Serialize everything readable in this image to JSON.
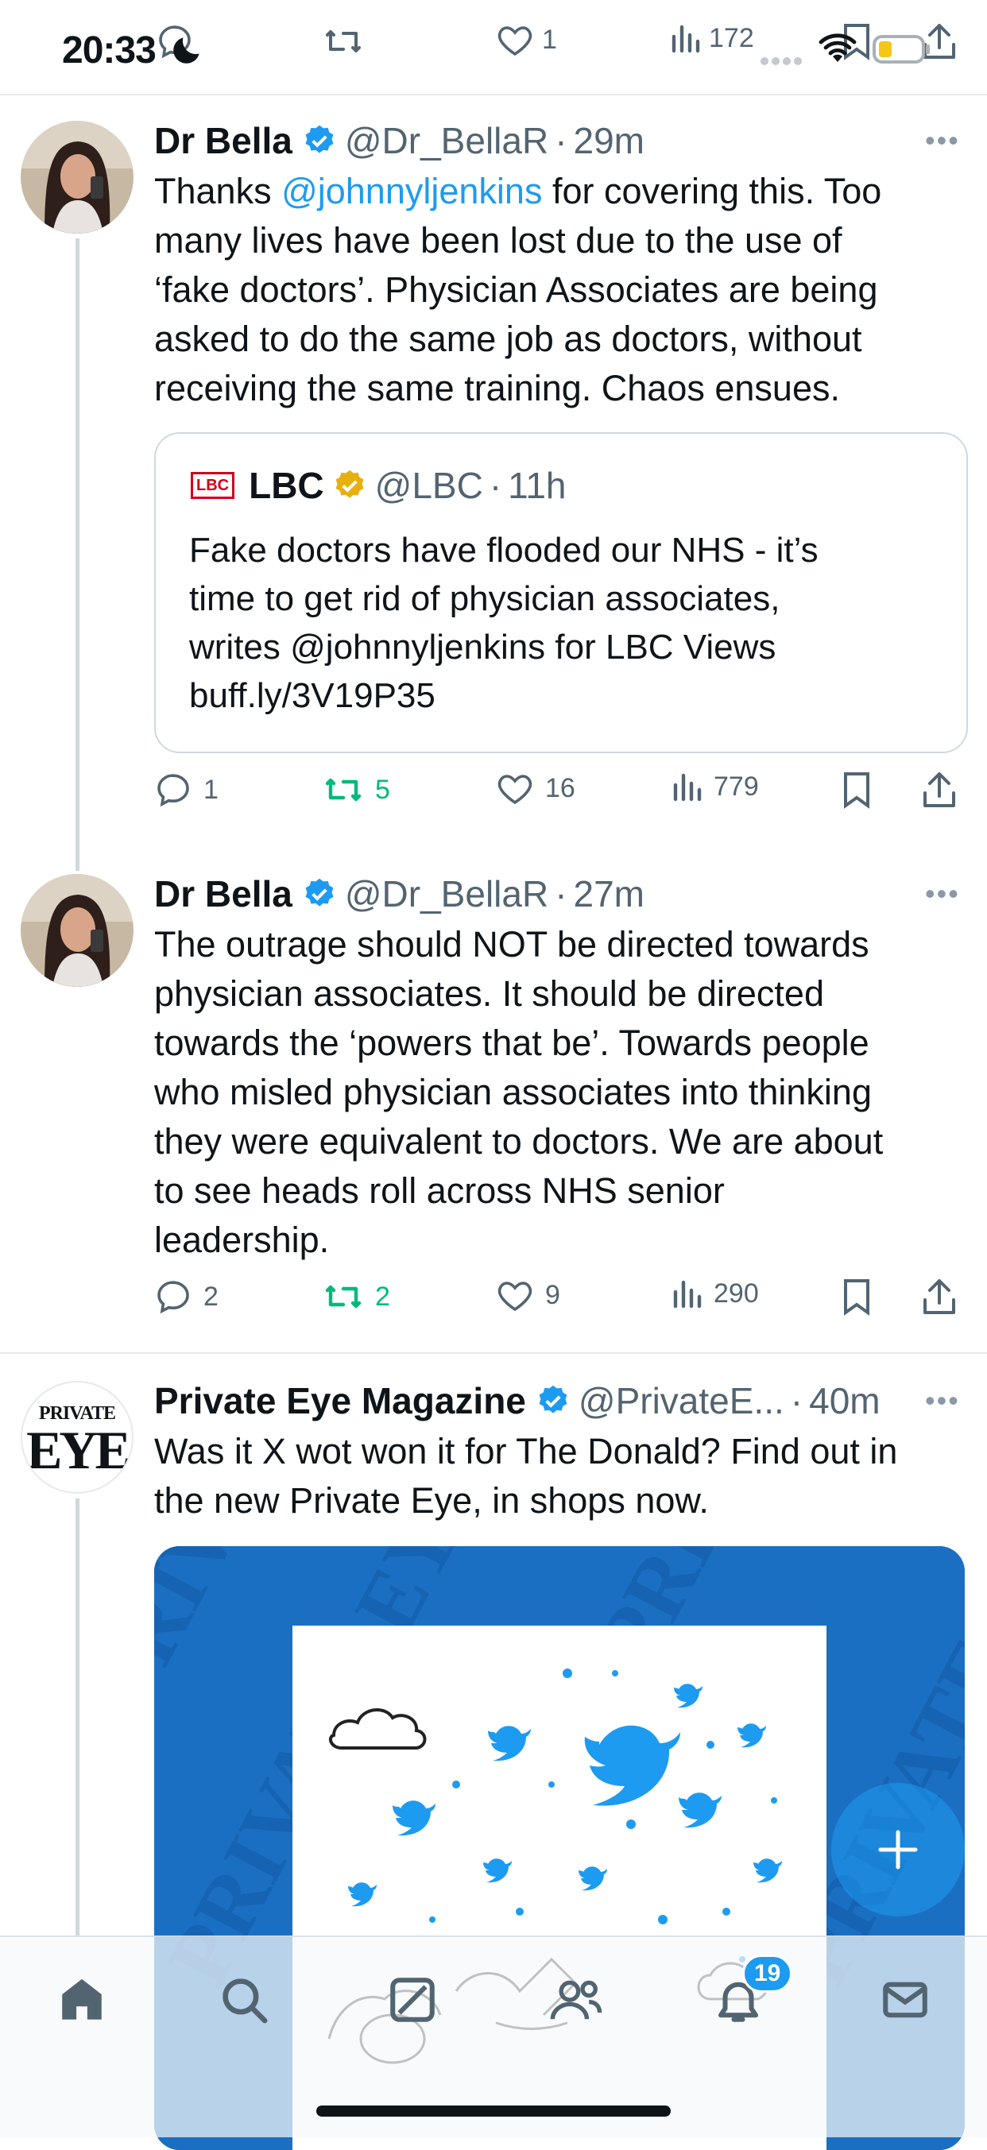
{
  "status_bar": {
    "time": "20:33",
    "battery_color": "#f5c518"
  },
  "top_actions": {
    "likes": "1",
    "views": "172"
  },
  "tweets": [
    {
      "name": "Dr Bella",
      "handle": "@Dr_BellaR",
      "time": "29m",
      "text_lines": [
        [
          "Thanks ",
          "@johnnyljenkins",
          " for covering this. Too"
        ],
        "many lives have been lost due to the use of",
        "‘fake doctors’. Physician Associates are being",
        "asked to do the same job as doctors, without",
        "receiving the same training. Chaos ensues."
      ],
      "quote": {
        "logo_text": "LBC",
        "name": "LBC",
        "handle": "@LBC",
        "time": "11h",
        "text_lines": [
          "Fake doctors have flooded our NHS - it’s",
          "time to get rid of physician associates,",
          "writes @johnnyljenkins for LBC Views",
          "buff.ly/3V19P35"
        ]
      },
      "replies": "1",
      "retweets": "5",
      "likes": "16",
      "views": "779"
    },
    {
      "name": "Dr Bella",
      "handle": "@Dr_BellaR",
      "time": "27m",
      "text_lines": [
        "The outrage should NOT be directed towards",
        "physician associates. It should be directed",
        "towards the ‘powers that be’. Towards people",
        "who misled physician associates into thinking",
        "they were equivalent to doctors. We are about",
        "to see heads roll across NHS senior",
        "leadership."
      ],
      "replies": "2",
      "retweets": "2",
      "likes": "9",
      "views": "290"
    },
    {
      "name": "Private Eye Magazine",
      "handle": "@PrivateE...",
      "time": "40m",
      "avatar_text_top": "PRIVATE",
      "avatar_text_bottom": "EYE",
      "text_lines": [
        "Was it X wot won it for The Donald? Find out in",
        "the new Private Eye, in shops now."
      ],
      "media_watermark": "PRIVATE EYE"
    }
  ],
  "nav": {
    "notifications_badge": "19"
  },
  "colors": {
    "accent": "#1d9bf0",
    "retweet_green": "#00ba7c",
    "verified_gold": "#e8b00f",
    "text_secondary": "#536471"
  }
}
